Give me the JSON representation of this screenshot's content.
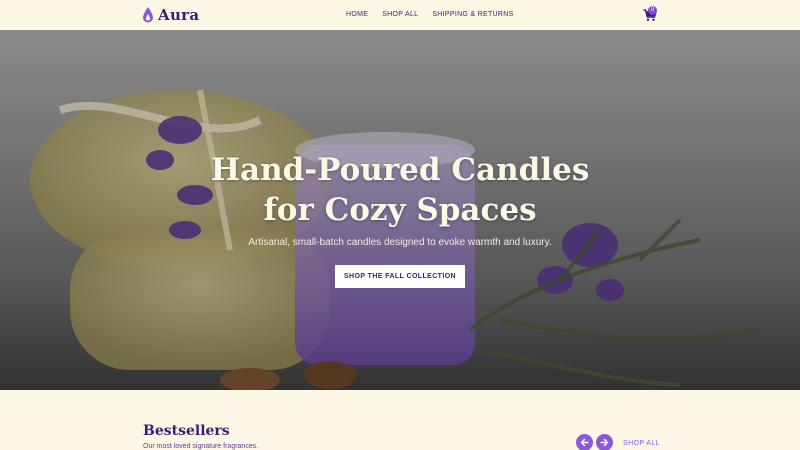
{
  "brand": {
    "name": "Aura"
  },
  "nav": [
    {
      "label": "HOME"
    },
    {
      "label": "SHOP ALL"
    },
    {
      "label": "SHIPPING & RETURNS"
    }
  ],
  "cart": {
    "count": "0",
    "icon": "cart-icon"
  },
  "hero": {
    "title_line1": "Hand-Poured Candles",
    "title_line2": "for Cozy Spaces",
    "subtitle": "Artisanal, small-batch candles designed to evoke warmth and luxury.",
    "cta": "SHOP THE FALL COLLECTION"
  },
  "bestsellers": {
    "title": "Bestsellers",
    "subtitle": "Our most loved signature fragrances.",
    "prev_icon": "arrow-left-icon",
    "next_icon": "arrow-right-icon",
    "shop_all": "SHOP ALL"
  },
  "colors": {
    "primary": "#3b1b78",
    "accent": "#8a5ad6",
    "background": "#fdf7e6"
  }
}
